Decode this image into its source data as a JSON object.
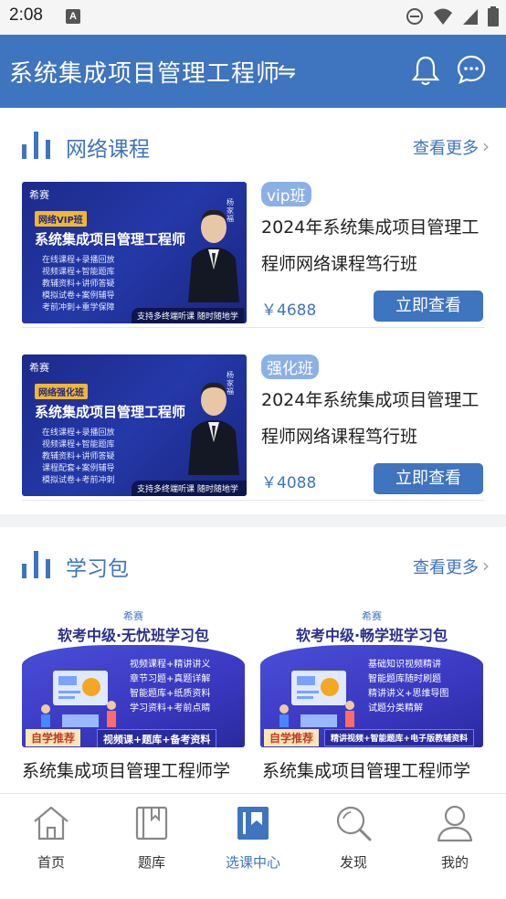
{
  "status_bar": {
    "time": "2:08",
    "notif_letter": "A"
  },
  "header": {
    "title": "系统集成项目管理工程师",
    "swap_symbol": "⇋"
  },
  "courses_section": {
    "title": "网络课程",
    "more": "查看更多",
    "items": [
      {
        "badge": "vip班",
        "name": "2024年系统集成项目管理工程师网络课程笃行班",
        "price": "￥4688",
        "button": "立即查看",
        "thumb": {
          "logo": "希赛",
          "tag": "网络VIP班",
          "title": "系统集成项目管理工程师",
          "lines": [
            "在线课程+录播回放",
            "视频课程+智能题库",
            "教辅资料+讲师答疑",
            "模拟试卷+案例辅导",
            "考前冲刺+重学保障"
          ],
          "teacher": "杨家福",
          "bottom": "支持多终端听课 随时随地学"
        }
      },
      {
        "badge": "强化班",
        "name": "2024年系统集成项目管理工程师网络课程笃行班",
        "price": "￥4088",
        "button": "立即查看",
        "thumb": {
          "logo": "希赛",
          "tag": "网络强化班",
          "title": "系统集成项目管理工程师",
          "lines": [
            "在线课程+录播回放",
            "视频课程+智能题库",
            "教辅资料+讲师答疑",
            "课程配套+案例辅导",
            "模拟试卷+考前冲刺"
          ],
          "teacher": "杨家福",
          "bottom": "支持多终端听课 随时随地学习"
        }
      }
    ]
  },
  "packs_section": {
    "title": "学习包",
    "more": "查看更多",
    "items": [
      {
        "logo": "希赛",
        "title": "软考中级·无忧班学习包",
        "lines": [
          "视频课程+精讲讲义",
          "章节习题+真题详解",
          "智能题库+纸质资料",
          "学习资料+考前点睛"
        ],
        "tag_left": "自学推荐",
        "tag_right": "视频课+题库+备考资料",
        "name": "系统集成项目管理工程师学"
      },
      {
        "logo": "希赛",
        "title": "软考中级·畅学班学习包",
        "lines": [
          "基础知识视频精讲",
          "智能题库随时刷题",
          "精讲讲义+思维导图",
          "试题分类精解"
        ],
        "tag_left": "自学推荐",
        "tag_right": "精讲视频+智能题库+电子版教辅资料",
        "name": "系统集成项目管理工程师学"
      }
    ]
  },
  "tabbar": {
    "tabs": [
      {
        "label": "首页",
        "icon": "home-icon"
      },
      {
        "label": "题库",
        "icon": "book-icon"
      },
      {
        "label": "选课中心",
        "icon": "course-center-icon"
      },
      {
        "label": "发现",
        "icon": "search-icon"
      },
      {
        "label": "我的",
        "icon": "user-icon"
      }
    ],
    "active_index": 2
  },
  "colors": {
    "primary": "#3f74bf",
    "badge": "#8bb0e6",
    "text": "#222222"
  }
}
